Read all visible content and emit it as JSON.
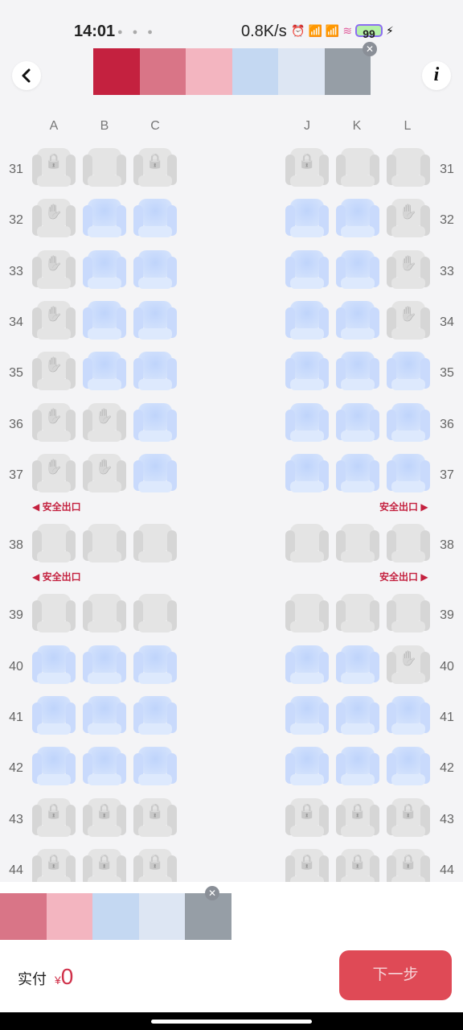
{
  "status_bar": {
    "time": "14:01",
    "network_speed": "0.8K/s",
    "battery": "99",
    "icons": [
      "alarm-icon",
      "hd-signal-icon",
      "hd-signal-icon",
      "wifi-icon",
      "battery-icon",
      "charging-icon"
    ]
  },
  "header": {
    "back_icon": "chevron-left-icon",
    "info_label": "i",
    "color_swatches": [
      "#c4213f",
      "#d97587",
      "#f3b5c0",
      "#c4d8f2",
      "#dde6f3",
      "#969ea6"
    ]
  },
  "columns": {
    "left": [
      "A",
      "B",
      "C"
    ],
    "right": [
      "J",
      "K",
      "L"
    ]
  },
  "exit_label": "安全出口",
  "rows": [
    {
      "num": "31",
      "seats": [
        "lock",
        "grey",
        "lock",
        "lock",
        "grey",
        "grey"
      ]
    },
    {
      "num": "32",
      "seats": [
        "hand",
        "blue",
        "blue",
        "blue",
        "blue",
        "hand"
      ]
    },
    {
      "num": "33",
      "seats": [
        "hand",
        "blue",
        "blue",
        "blue",
        "blue",
        "hand"
      ]
    },
    {
      "num": "34",
      "seats": [
        "hand",
        "blue",
        "blue",
        "blue",
        "blue",
        "hand"
      ]
    },
    {
      "num": "35",
      "seats": [
        "hand",
        "blue",
        "blue",
        "blue",
        "blue",
        "blue"
      ]
    },
    {
      "num": "36",
      "seats": [
        "hand",
        "hand",
        "blue",
        "blue",
        "blue",
        "blue"
      ]
    },
    {
      "num": "37",
      "seats": [
        "hand",
        "hand",
        "blue",
        "blue",
        "blue",
        "blue"
      ]
    },
    {
      "num": "38",
      "seats": [
        "grey",
        "grey",
        "grey",
        "grey",
        "grey",
        "grey"
      ],
      "exit_before": true
    },
    {
      "num": "39",
      "seats": [
        "grey",
        "grey",
        "grey",
        "grey",
        "grey",
        "grey"
      ],
      "exit_before": true
    },
    {
      "num": "40",
      "seats": [
        "blue",
        "blue",
        "blue",
        "blue",
        "blue",
        "hand"
      ]
    },
    {
      "num": "41",
      "seats": [
        "blue",
        "blue",
        "blue",
        "blue",
        "blue",
        "blue"
      ]
    },
    {
      "num": "42",
      "seats": [
        "blue",
        "blue",
        "blue",
        "blue",
        "blue",
        "blue"
      ]
    },
    {
      "num": "43",
      "seats": [
        "lock",
        "lock",
        "lock",
        "lock",
        "lock",
        "lock"
      ]
    },
    {
      "num": "44",
      "seats": [
        "lock",
        "lock",
        "lock",
        "lock",
        "lock",
        "lock"
      ]
    }
  ],
  "bottom_swatches": [
    "#d97587",
    "#f3b5c0",
    "#c4d8f2",
    "#dde6f3",
    "#969ea6"
  ],
  "footer": {
    "pay_label": "实付",
    "currency": "¥",
    "amount": "0",
    "next_label": "下一步"
  }
}
